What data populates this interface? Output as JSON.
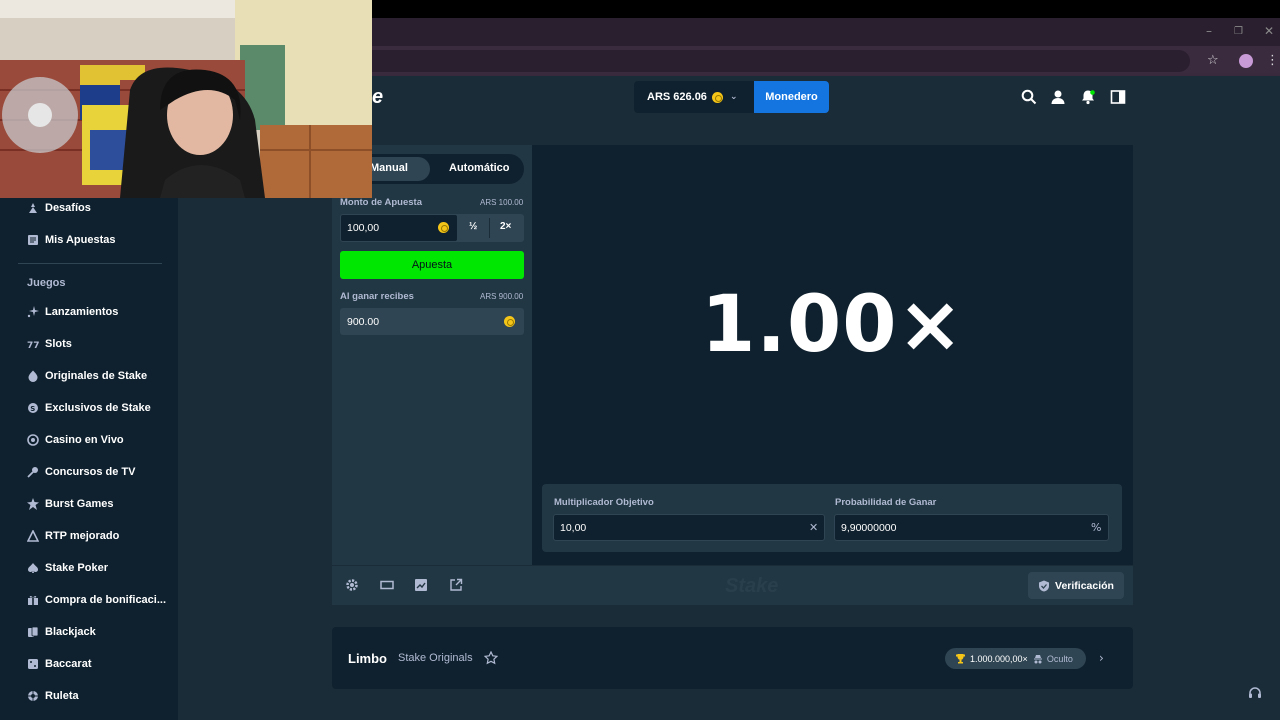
{
  "browser": {
    "minimize": "–",
    "restore": "❐",
    "close": "✕",
    "bookmark_icon": "star-icon",
    "menu_icon": "kebab-icon"
  },
  "header": {
    "logo_fragment": "e",
    "balance": "ARS 626.06",
    "wallet_label": "Monedero",
    "icons": [
      "search-icon",
      "user-icon",
      "bell-icon",
      "sidebar-toggle-icon"
    ]
  },
  "sidebar": {
    "top_items": [
      {
        "label": "Desafíos",
        "icon": "challenge-icon"
      },
      {
        "label": "Mis Apuestas",
        "icon": "bets-icon"
      }
    ],
    "heading": "Juegos",
    "items": [
      {
        "label": "Lanzamientos",
        "icon": "sparkle-icon"
      },
      {
        "label": "Slots",
        "icon": "slots-icon"
      },
      {
        "label": "Originales de Stake",
        "icon": "originals-icon"
      },
      {
        "label": "Exclusivos de Stake",
        "icon": "exclusive-icon"
      },
      {
        "label": "Casino en Vivo",
        "icon": "live-icon"
      },
      {
        "label": "Concursos de TV",
        "icon": "tv-icon"
      },
      {
        "label": "Burst Games",
        "icon": "burst-icon"
      },
      {
        "label": "RTP mejorado",
        "icon": "rtp-icon"
      },
      {
        "label": "Stake Poker",
        "icon": "poker-icon"
      },
      {
        "label": "Compra de bonificaci...",
        "icon": "gift-icon"
      },
      {
        "label": "Blackjack",
        "icon": "blackjack-icon"
      },
      {
        "label": "Baccarat",
        "icon": "baccarat-icon"
      },
      {
        "label": "Ruleta",
        "icon": "roulette-icon"
      }
    ]
  },
  "bet_panel": {
    "mode_manual": "Manual",
    "mode_auto": "Automático",
    "amount_label": "Monto de Apuesta",
    "amount_hint": "ARS 100.00",
    "amount_value": "100,00",
    "half_label": "½",
    "double_label": "2×",
    "bet_button": "Apuesta",
    "payout_label": "Al ganar recibes",
    "payout_hint": "ARS 900.00",
    "payout_value": "900.00"
  },
  "game": {
    "multiplier": "1.00×",
    "target_label": "Multiplicador Objetivo",
    "target_value": "10,00",
    "target_suffix": "✕",
    "chance_label": "Probabilidad de Ganar",
    "chance_value": "9,90000000",
    "chance_suffix": "%"
  },
  "toolbar": {
    "watermark": "Stake",
    "verify_label": "Verificación"
  },
  "info": {
    "game_name": "Limbo",
    "provider": "Stake Originals",
    "max_win": "1.000.000,00×",
    "hidden_label": "Oculto"
  }
}
